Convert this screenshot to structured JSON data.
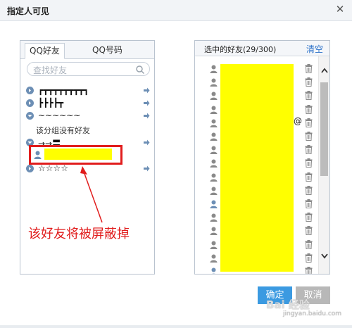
{
  "dialog": {
    "title": "指定人可见",
    "close_icon": "close-icon"
  },
  "left": {
    "tabs": [
      "QQ好友",
      "QQ号码"
    ],
    "search_placeholder": "查找好友",
    "groups": [
      {
        "name": "┏┳┳┳┳┳┳┳┳┓",
        "state": "collapsed"
      },
      {
        "name": "┣┣┣┣┳",
        "state": "collapsed"
      },
      {
        "name": "~~~~~~",
        "state": "expanded"
      },
      {
        "name": "→→〓",
        "state": "expanded"
      },
      {
        "name": "☆☆☆☆",
        "state": "collapsed"
      }
    ],
    "empty_group_note": "该分组没有好友",
    "annotation": "该好友将被屏蔽掉"
  },
  "right": {
    "selected_count": "选中的好友(29/300)",
    "clear_label": "清空",
    "at_symbol": "@"
  },
  "buttons": {
    "ok": "确定",
    "cancel": "取消"
  },
  "watermark": {
    "text": "Bai 经验",
    "sub": "jingyan.baidu.com"
  },
  "colors": {
    "accent": "#3b9ae1",
    "highlight": "#e11d1d",
    "mask": "#ffff00"
  }
}
